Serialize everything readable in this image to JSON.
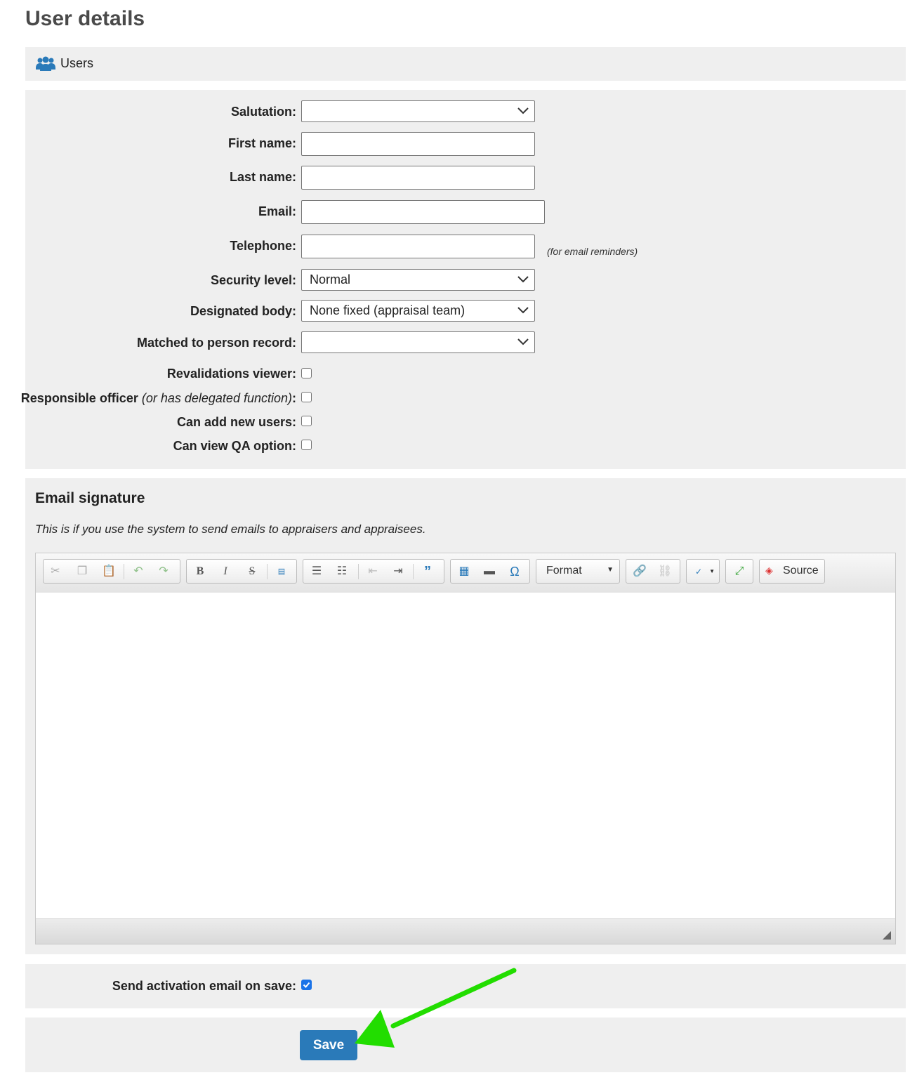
{
  "page": {
    "title": "User details"
  },
  "breadcrumb": {
    "label": "Users",
    "icon": "users-icon"
  },
  "form": {
    "salutation": {
      "label": "Salutation:",
      "value": ""
    },
    "first_name": {
      "label": "First name:",
      "value": ""
    },
    "last_name": {
      "label": "Last name:",
      "value": ""
    },
    "email": {
      "label": "Email:",
      "value": ""
    },
    "telephone": {
      "label": "Telephone:",
      "value": "",
      "hint": "(for email reminders)"
    },
    "security_level": {
      "label": "Security level:",
      "value": "Normal"
    },
    "designated_body": {
      "label": "Designated body:",
      "value": "None fixed (appraisal team)"
    },
    "matched_person": {
      "label": "Matched to person record:",
      "value": ""
    },
    "revalidations_viewer": {
      "label": "Revalidations viewer:",
      "checked": false
    },
    "responsible_officer": {
      "label": "Responsible officer",
      "label_note": "(or has delegated function)",
      "label_suffix": ":",
      "checked": false
    },
    "can_add_users": {
      "label": "Can add new users:",
      "checked": false
    },
    "can_view_qa": {
      "label": "Can view QA option:",
      "checked": false
    }
  },
  "signature": {
    "title": "Email signature",
    "description": "This is if you use the system to send emails to appraisers and appraisees.",
    "toolbar": {
      "format_label": "Format",
      "source_label": "Source"
    }
  },
  "activation": {
    "label": "Send activation email on save:",
    "checked": true
  },
  "actions": {
    "save_label": "Save"
  },
  "colors": {
    "accent": "#2a7ab9",
    "panel_bg": "#efefef",
    "arrow": "#22dd00"
  }
}
